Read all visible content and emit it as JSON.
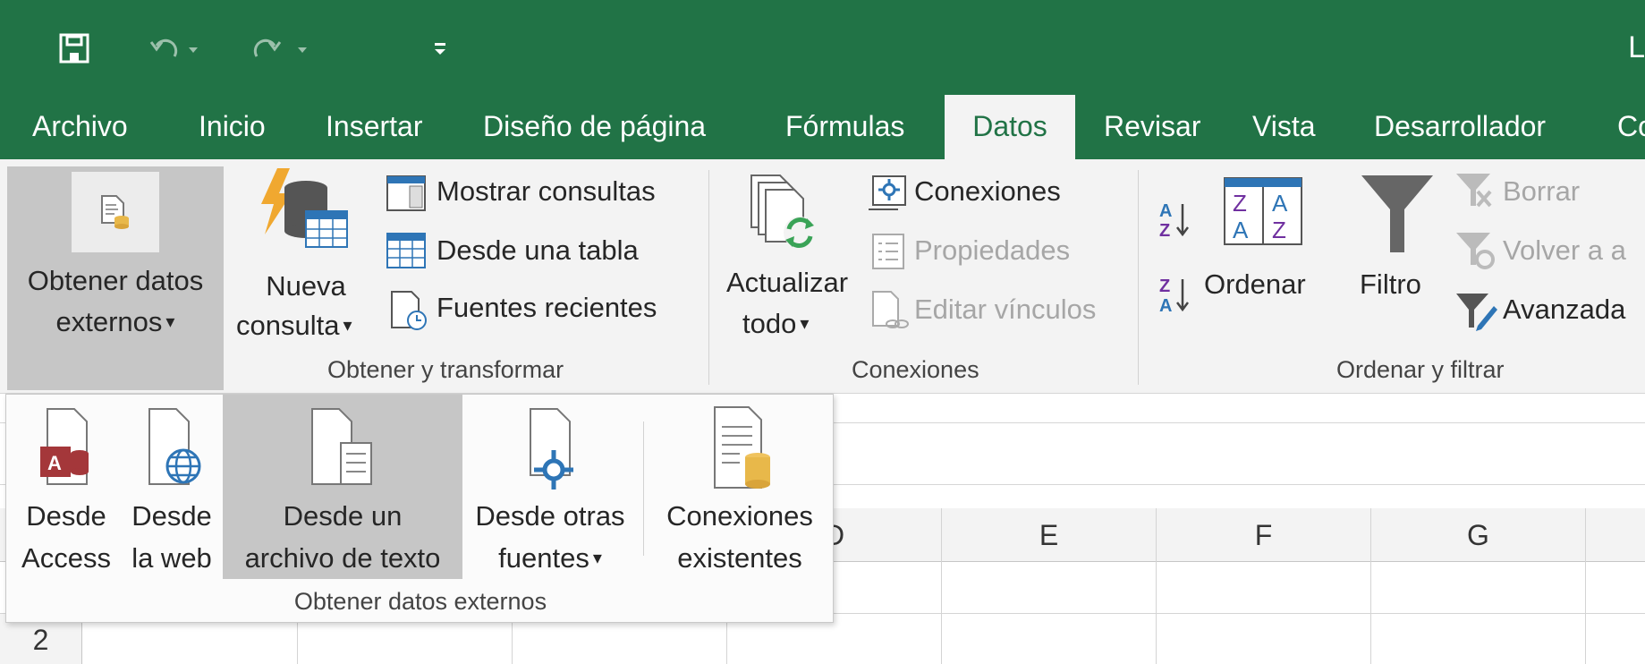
{
  "title_bar": {
    "window_title": "L",
    "qat": {
      "save_icon": "save-icon",
      "undo_icon": "undo-icon",
      "redo_icon": "redo-icon",
      "customize_icon": "customize-qat-icon"
    }
  },
  "tabs": [
    {
      "label": "Archivo"
    },
    {
      "label": "Inicio"
    },
    {
      "label": "Insertar"
    },
    {
      "label": "Diseño de página"
    },
    {
      "label": "Fórmulas"
    },
    {
      "label": "Datos",
      "active": true
    },
    {
      "label": "Revisar"
    },
    {
      "label": "Vista"
    },
    {
      "label": "Desarrollador"
    },
    {
      "label": "Co"
    }
  ],
  "ribbon": {
    "obtener_datos": {
      "line1": "Obtener datos",
      "line2": "externos",
      "icon": "external-data-icon"
    },
    "nueva_consulta": {
      "line1": "Nueva",
      "line2": "consulta",
      "icon": "new-query-icon"
    },
    "mostrar_consultas": "Mostrar consultas",
    "desde_una_tabla": "Desde una tabla",
    "fuentes_recientes": "Fuentes recientes",
    "group_obtener": "Obtener y transformar",
    "actualizar": {
      "line1": "Actualizar",
      "line2": "todo",
      "icon": "refresh-all-icon"
    },
    "conexiones": "Conexiones",
    "propiedades": "Propiedades",
    "editar_vinculos": "Editar vínculos",
    "group_conexiones": "Conexiones",
    "ordenar": "Ordenar",
    "filtro": "Filtro",
    "borrar": "Borrar",
    "volver": "Volver a a",
    "avanzadas": "Avanzada",
    "group_ordenar": "Ordenar y filtrar"
  },
  "dropdown": {
    "items": [
      {
        "line1": "Desde",
        "line2": "Access",
        "icon": "access-icon"
      },
      {
        "line1": "Desde",
        "line2": "la web",
        "icon": "web-icon"
      },
      {
        "line1": "Desde un",
        "line2": "archivo de texto",
        "icon": "text-file-icon",
        "hover": true
      },
      {
        "line1": "Desde otras",
        "line2": "fuentes",
        "icon": "other-sources-icon"
      },
      {
        "line1": "Conexiones",
        "line2": "existentes",
        "icon": "existing-connections-icon"
      }
    ],
    "group_label": "Obtener datos externos"
  },
  "grid": {
    "columns": [
      "D",
      "E",
      "F",
      "G"
    ],
    "rows": [
      "2"
    ]
  }
}
